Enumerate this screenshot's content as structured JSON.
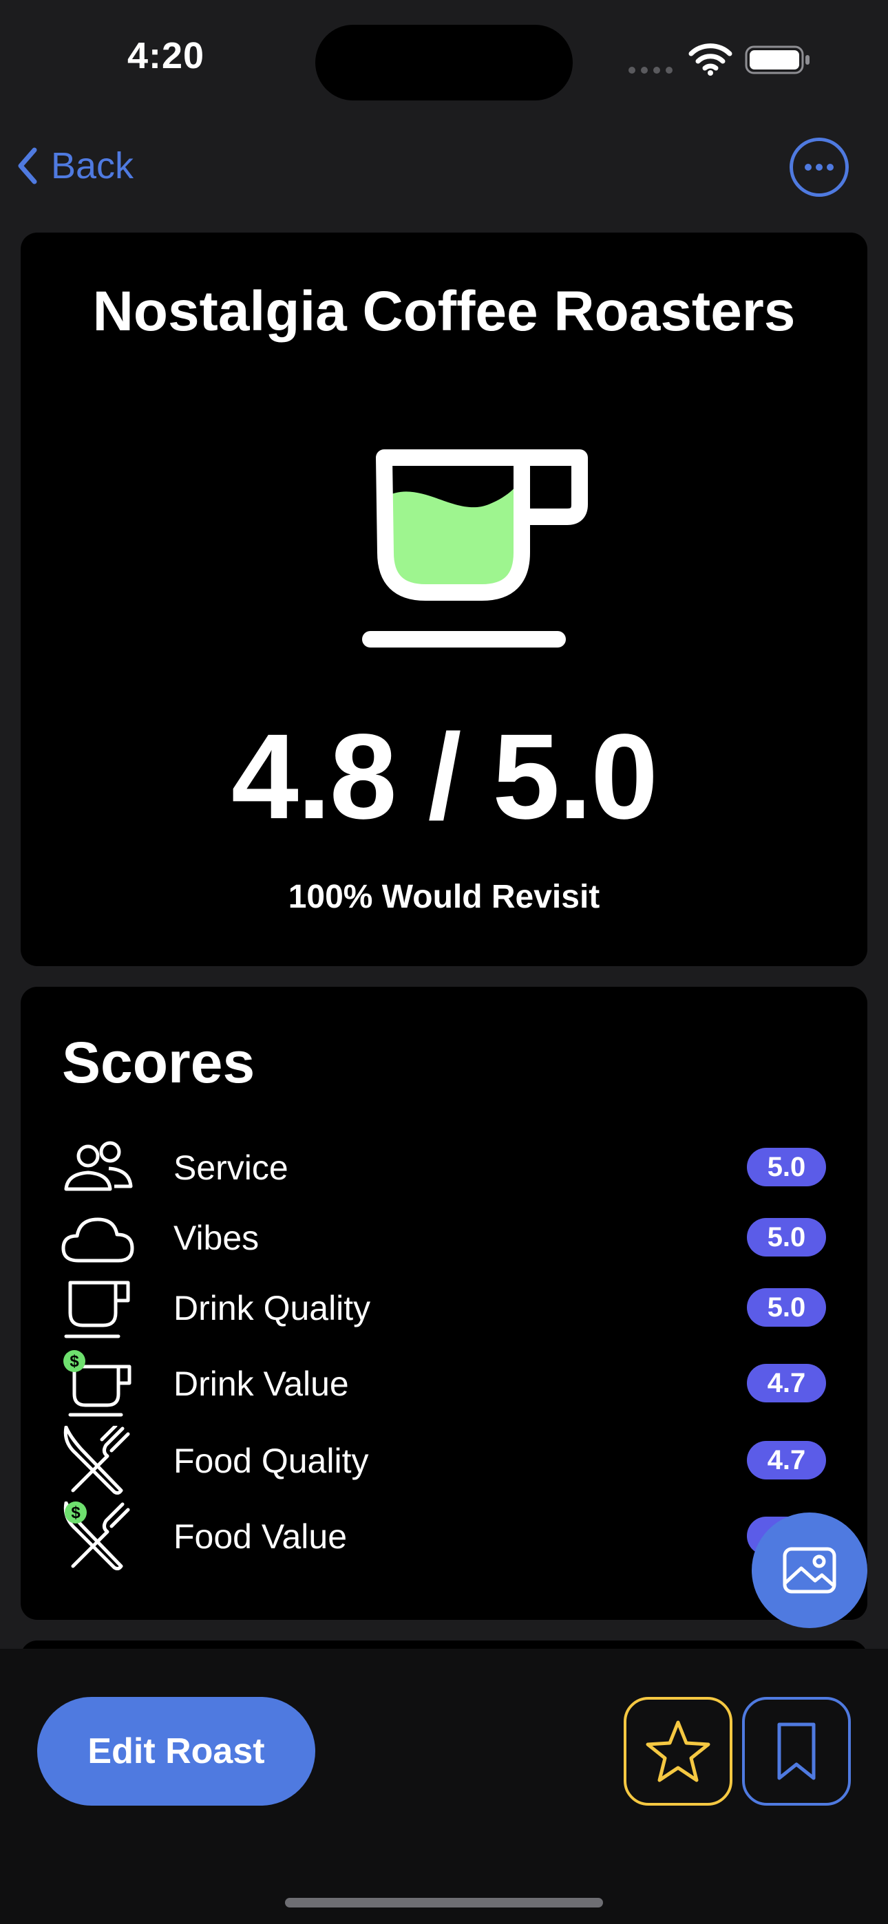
{
  "status": {
    "time": "4:20"
  },
  "nav": {
    "back_label": "Back"
  },
  "hero": {
    "title": "Nostalgia Coffee Roasters",
    "rating": "4.8 / 5.0",
    "revisit": "100% Would Revisit",
    "cup_fill_color": "#9ef58f"
  },
  "scores": {
    "title": "Scores",
    "items": [
      {
        "icon": "people-icon",
        "label": "Service",
        "value": "5.0"
      },
      {
        "icon": "cloud-icon",
        "label": "Vibes",
        "value": "5.0"
      },
      {
        "icon": "cup-icon",
        "label": "Drink Quality",
        "value": "5.0"
      },
      {
        "icon": "cup-dollar-icon",
        "label": "Drink Value",
        "value": "4.7"
      },
      {
        "icon": "utensils-icon",
        "label": "Food Quality",
        "value": "4.7"
      },
      {
        "icon": "utensils-dollar-icon",
        "label": "Food Value",
        "value": ""
      }
    ]
  },
  "actions": {
    "edit_label": "Edit Roast"
  },
  "colors": {
    "accent": "#4f7ae0",
    "badge": "#5b5ce8",
    "star": "#f5c842",
    "dollar_badge": "#6ee06e"
  }
}
